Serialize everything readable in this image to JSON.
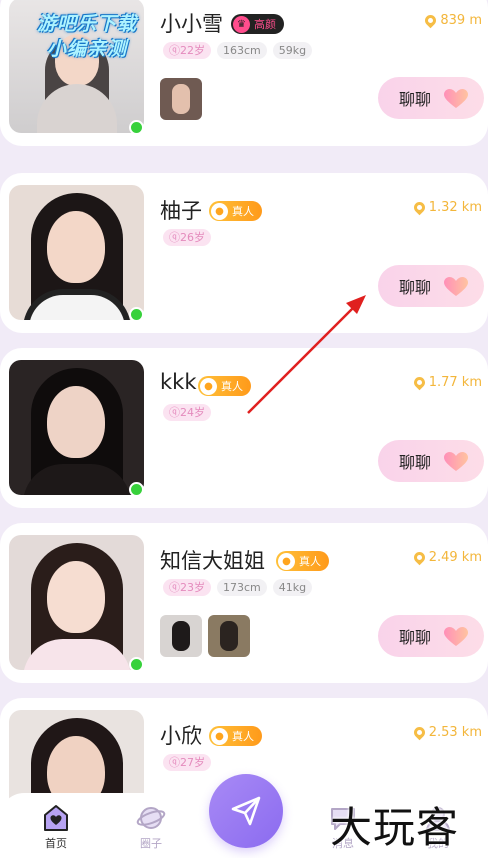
{
  "watermark_top": [
    "游吧乐下载",
    "小编亲测"
  ],
  "watermark_bottom": "大玩客",
  "chat_label": "聊聊",
  "users": [
    {
      "name": "小小雪",
      "badge_text": "高颜",
      "badge_type": "pretty",
      "distance": "839 m",
      "age": "22岁",
      "height": "163cm",
      "weight": "59kg",
      "photos": 1,
      "online": true
    },
    {
      "name": "柚子",
      "badge_text": "真人",
      "badge_type": "real",
      "distance": "1.32 km",
      "age": "26岁",
      "photos": 0,
      "online": true
    },
    {
      "name": "kkk",
      "badge_text": "真人",
      "badge_type": "real",
      "distance": "1.77 km",
      "age": "24岁",
      "photos": 0,
      "online": true
    },
    {
      "name": "知信大姐姐",
      "badge_text": "真人",
      "badge_type": "real",
      "distance": "2.49 km",
      "age": "23岁",
      "height": "173cm",
      "weight": "41kg",
      "photos": 2,
      "online": true
    },
    {
      "name": "小欣",
      "badge_text": "真人",
      "badge_type": "real",
      "distance": "2.53 km",
      "age": "27岁",
      "photos": 0,
      "online": false
    }
  ],
  "tabbar": {
    "items": [
      {
        "label": "首页",
        "icon": "home-icon",
        "active": true
      },
      {
        "label": "圈子",
        "icon": "planet-icon",
        "active": false
      },
      {
        "label": "消息",
        "icon": "message-icon",
        "active": false
      },
      {
        "label": "我的",
        "icon": "profile-icon",
        "active": false
      }
    ],
    "center_icon": "send-icon"
  },
  "colors": {
    "accent": "#8b6bf0",
    "distance": "#f3b63b",
    "online": "#37d13b",
    "chat_button": "#f9d3ea"
  }
}
